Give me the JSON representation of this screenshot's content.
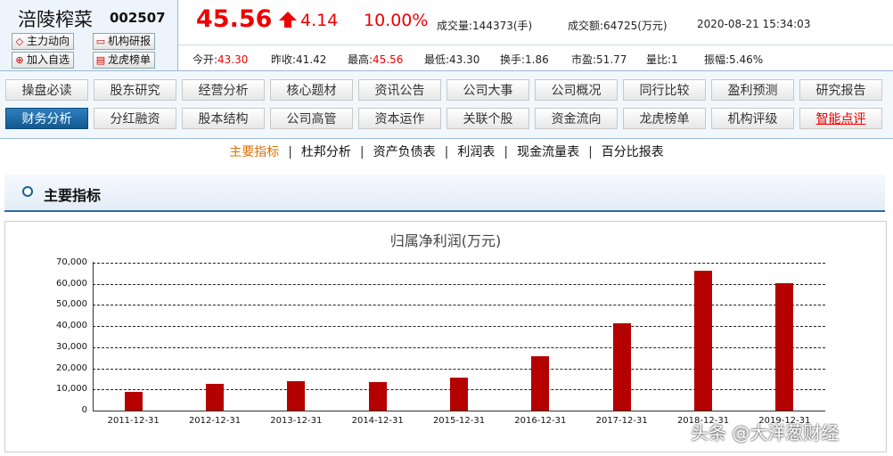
{
  "stock": {
    "name": "涪陵榨菜",
    "code": "002507",
    "buttons": [
      {
        "label": "主力动向",
        "icon": "diamond-icon"
      },
      {
        "label": "机构研报",
        "icon": "folder-icon"
      },
      {
        "label": "加入自选",
        "icon": "plus-icon"
      },
      {
        "label": "龙虎榜单",
        "icon": "list-icon"
      }
    ]
  },
  "quote": {
    "price": "45.56",
    "change": "4.14",
    "change_pct": "10.00%",
    "volume_label": "成交量:",
    "volume_value": "144373(手)",
    "amount_label": "成交额:",
    "amount_value": "64725(万元)",
    "datetime": "2020-08-21 15:34:03"
  },
  "stats": [
    {
      "label": "今开:",
      "value": "43.30",
      "red": true
    },
    {
      "label": "昨收:",
      "value": "41.42",
      "red": false
    },
    {
      "label": "最高:",
      "value": "45.56",
      "red": true
    },
    {
      "label": "最低:",
      "value": "43.30",
      "red": false
    },
    {
      "label": "换手:",
      "value": "1.86",
      "red": false
    },
    {
      "label": "市盈:",
      "value": "51.77",
      "red": false
    },
    {
      "label": "量比:",
      "value": "1",
      "red": false
    },
    {
      "label": "振幅:",
      "value": "5.46%",
      "red": false
    }
  ],
  "nav": {
    "row1": [
      "操盘必读",
      "股东研究",
      "经营分析",
      "核心题材",
      "资讯公告",
      "公司大事",
      "公司概况",
      "同行比较",
      "盈利预测",
      "研究报告"
    ],
    "row2": [
      "财务分析",
      "分红融资",
      "股本结构",
      "公司高管",
      "资本运作",
      "关联个股",
      "资金流向",
      "龙虎榜单",
      "机构评级",
      "智能点评"
    ],
    "active": "财务分析",
    "highlight": "智能点评"
  },
  "subtabs": [
    "主要指标",
    "杜邦分析",
    "资产负债表",
    "利润表",
    "现金流量表",
    "百分比报表"
  ],
  "section_title": "主要指标",
  "chart_data": {
    "type": "bar",
    "title": "归属净利润(万元)",
    "categories": [
      "2011-12-31",
      "2012-12-31",
      "2013-12-31",
      "2014-12-31",
      "2015-12-31",
      "2016-12-31",
      "2017-12-31",
      "2018-12-31",
      "2019-12-31"
    ],
    "values": [
      8900,
      12500,
      14100,
      13300,
      15600,
      25800,
      41300,
      66100,
      60500
    ],
    "ylim": [
      0,
      70000
    ],
    "yticks": [
      "0",
      "10,000",
      "20,000",
      "30,000",
      "40,000",
      "50,000",
      "60,000",
      "70,000"
    ],
    "grid": true,
    "bar_color": "#b50000"
  },
  "watermark": "头条 @大洋葱财经"
}
